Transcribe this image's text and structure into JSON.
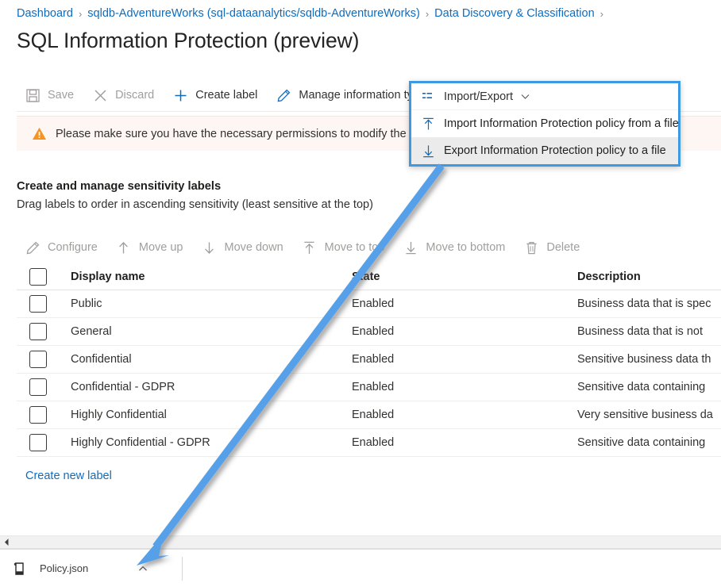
{
  "breadcrumb": {
    "separator": "›",
    "items": [
      {
        "label": "Dashboard"
      },
      {
        "label": "sqldb-AdventureWorks (sql-dataanalytics/sqldb-AdventureWorks)"
      },
      {
        "label": "Data Discovery & Classification"
      }
    ]
  },
  "page": {
    "title": "SQL Information Protection (preview)",
    "accent_color": "#0f6cbd",
    "highlight_color": "#3d9ae2",
    "warning_bg": "#fdf6f3"
  },
  "commandbar": {
    "items": [
      {
        "label": "Save",
        "icon": "save-icon",
        "disabled": true
      },
      {
        "label": "Discard",
        "icon": "discard-icon",
        "disabled": true
      },
      {
        "label": "Create label",
        "icon": "plus-icon",
        "disabled": false
      },
      {
        "label": "Manage information types",
        "icon": "pencil-icon",
        "disabled": false
      }
    ]
  },
  "import_export": {
    "trigger_label": "Import/Export",
    "trigger_icon": "list-icon",
    "chevron_icon": "chevron-down-icon",
    "items": [
      {
        "label": "Import Information Protection policy from a file",
        "icon": "upload-icon",
        "hovered": false
      },
      {
        "label": "Export Information Protection policy to a file",
        "icon": "download-icon",
        "hovered": true
      }
    ]
  },
  "warning": {
    "icon": "warning-icon",
    "text": "Please make sure you have the necessary permissions to modify the Informat"
  },
  "section": {
    "title": "Create and manage sensitivity labels",
    "subtitle": "Drag labels to order in ascending sensitivity (least sensitive at the top)"
  },
  "label_actions": {
    "items": [
      {
        "label": "Configure",
        "icon": "pencil-icon",
        "disabled": true
      },
      {
        "label": "Move up",
        "icon": "arrow-up-icon",
        "disabled": true
      },
      {
        "label": "Move down",
        "icon": "arrow-down-icon",
        "disabled": true
      },
      {
        "label": "Move to top",
        "icon": "arrow-to-top-icon",
        "disabled": true
      },
      {
        "label": "Move to bottom",
        "icon": "arrow-to-bottom-icon",
        "disabled": true
      },
      {
        "label": "Delete",
        "icon": "trash-icon",
        "disabled": true
      }
    ]
  },
  "table": {
    "columns": [
      "Display name",
      "State",
      "Description"
    ],
    "rows": [
      {
        "name": "Public",
        "state": "Enabled",
        "description": "Business data that is spec"
      },
      {
        "name": "General",
        "state": "Enabled",
        "description": "Business data that is not"
      },
      {
        "name": "Confidential",
        "state": "Enabled",
        "description": "Sensitive business data th"
      },
      {
        "name": "Confidential - GDPR",
        "state": "Enabled",
        "description": "Sensitive data containing"
      },
      {
        "name": "Highly Confidential",
        "state": "Enabled",
        "description": "Very sensitive business da"
      },
      {
        "name": "Highly Confidential - GDPR",
        "state": "Enabled",
        "description": "Sensitive data containing"
      }
    ]
  },
  "create_new_label": {
    "label": "Create new label"
  },
  "download_shelf": {
    "file_name": "Policy.json",
    "file_icon": "json-file-icon",
    "expand_icon": "chevron-up-icon"
  },
  "scrollbar": {
    "left_arrow_icon": "caret-left-icon"
  }
}
